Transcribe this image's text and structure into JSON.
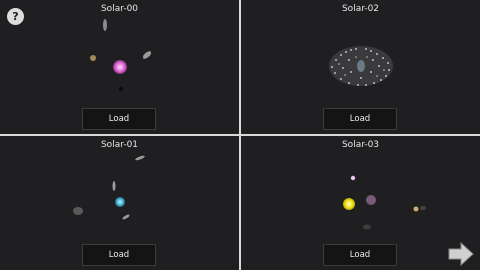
{
  "help": {
    "icon": "question-mark-icon",
    "glyph": "?"
  },
  "slots": [
    {
      "title": "Solar-00",
      "load_label": "Load"
    },
    {
      "title": "Solar-02",
      "load_label": "Load"
    },
    {
      "title": "Solar-01",
      "load_label": "Load"
    },
    {
      "title": "Solar-03",
      "load_label": "Load"
    }
  ],
  "next": {
    "icon": "arrow-right-icon"
  },
  "colors": {
    "background": "#1f1f21",
    "divider": "#d9d9d9",
    "button_bg": "#141414",
    "text": "#e6e6e6"
  }
}
